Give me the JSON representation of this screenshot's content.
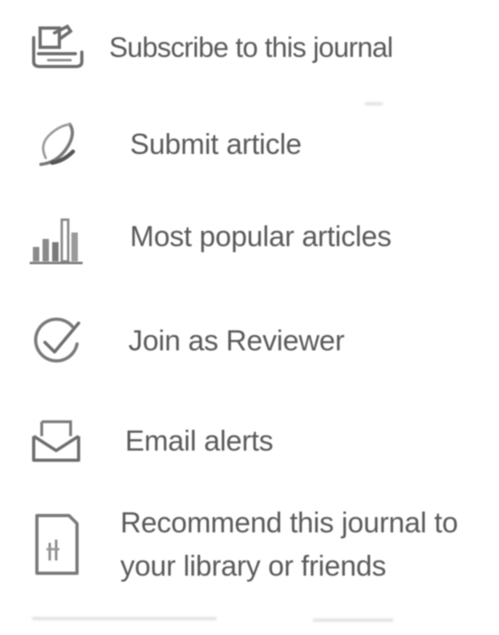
{
  "menu": {
    "items": [
      {
        "id": "subscribe",
        "label": "Subscribe to this journal",
        "icon": "subscribe-journal-icon"
      },
      {
        "id": "submit",
        "label": "Submit article",
        "icon": "pen-nib-icon"
      },
      {
        "id": "popular",
        "label": "Most popular articles",
        "icon": "bar-chart-icon"
      },
      {
        "id": "reviewer",
        "label": "Join as Reviewer",
        "icon": "checkmark-circle-icon"
      },
      {
        "id": "email",
        "label": "Email alerts",
        "icon": "envelope-icon"
      },
      {
        "id": "recommend",
        "label": "Recommend this journal to your library or friends",
        "icon": "document-icon"
      }
    ]
  },
  "colors": {
    "text": "#5a5a5a",
    "icon": "#6e6e6e",
    "background": "#ffffff"
  }
}
